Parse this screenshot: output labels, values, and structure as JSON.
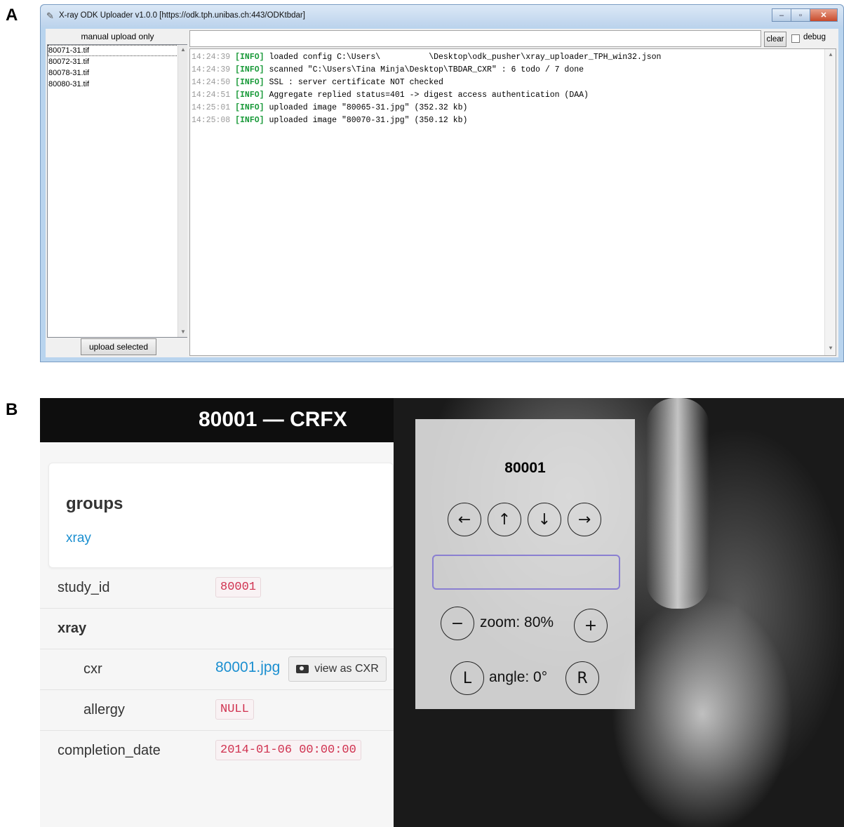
{
  "panel_labels": {
    "a": "A",
    "b": "B"
  },
  "uploader": {
    "window_title": "X-ray ODK Uploader v1.0.0 [https://odk.tph.unibas.ch:443/ODKtbdar]",
    "manual_label": "manual upload only",
    "files": [
      "80071-31.tif",
      "80072-31.tif",
      "80078-31.tif",
      "80080-31.tif"
    ],
    "upload_button": "upload selected",
    "command_value": "",
    "clear_button": "clear",
    "debug_label": "debug",
    "debug_checked": false,
    "log": [
      {
        "time": "14:24:39",
        "level": "[INFO]",
        "msg": "loaded config C:\\Users\\          \\Desktop\\odk_pusher\\xray_uploader_TPH_win32.json"
      },
      {
        "time": "14:24:39",
        "level": "[INFO]",
        "msg": "scanned \"C:\\Users\\Tina Minja\\Desktop\\TBDAR_CXR\" : 6 todo / 7 done"
      },
      {
        "time": "14:24:50",
        "level": "[INFO]",
        "msg": "SSL : server certificate NOT checked"
      },
      {
        "time": "14:24:51",
        "level": "[INFO]",
        "msg": "Aggregate replied status=401 -> digest access authentication (DAA)"
      },
      {
        "time": "14:25:01",
        "level": "[INFO]",
        "msg": "uploaded image \"80065-31.jpg\" (352.32 kb)"
      },
      {
        "time": "14:25:08",
        "level": "[INFO]",
        "msg": "uploaded image \"80070-31.jpg\" (350.12 kb)"
      }
    ],
    "colors": {
      "timestamp": "#9a9a9a",
      "info_tag": "#1a9a3a"
    }
  },
  "record": {
    "header": "80001 — CRFX",
    "groups_heading": "groups",
    "groups_link": "xray",
    "study_id_label": "study_id",
    "study_id_value": "80001",
    "xray_label": "xray",
    "cxr_label": "cxr",
    "cxr_link": "80001.jpg",
    "view_button": "view as CXR",
    "allergy_label": "allergy",
    "allergy_value": "NULL",
    "completion_label": "completion_date",
    "completion_value": "2014-01-06 00:00:00",
    "colors": {
      "link": "#1b8fd0",
      "code_text": "#d0314f",
      "header_bg": "#0e0e0e"
    }
  },
  "viewer": {
    "image_id": "80001",
    "arrows": {
      "left": "←",
      "up": "↑",
      "down": "↓",
      "right": "→"
    },
    "input_value": "",
    "zoom_minus": "−",
    "zoom_text": "zoom: 80%",
    "zoom_plus": "+",
    "rotate_left": "L",
    "angle_text": "angle: 0°",
    "rotate_right": "R"
  }
}
